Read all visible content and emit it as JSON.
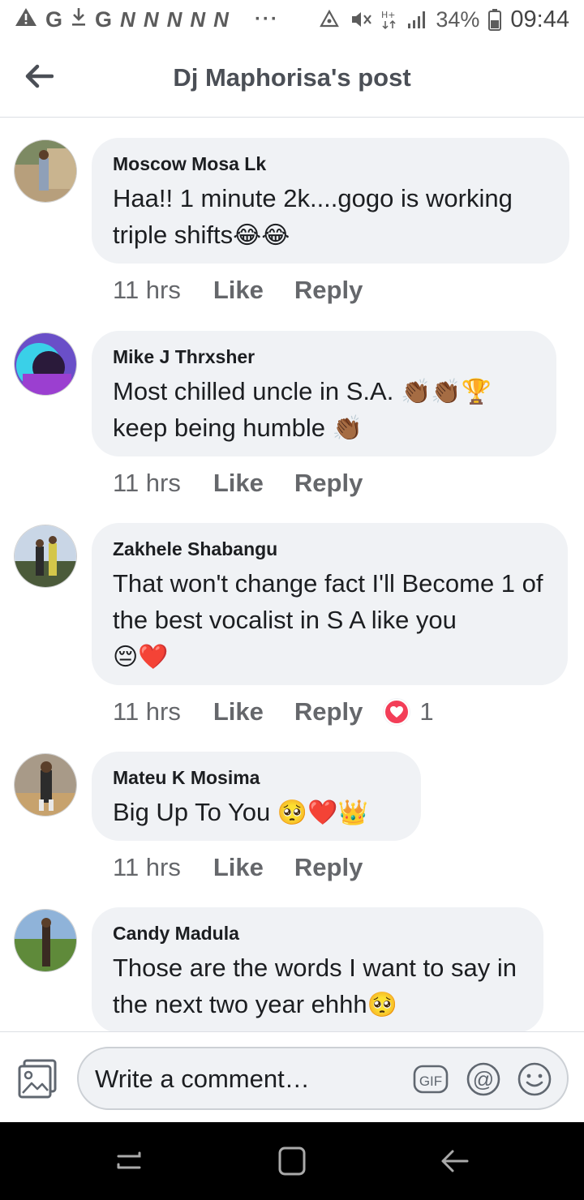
{
  "status_bar": {
    "left_glyphs": [
      "A",
      "G",
      "G"
    ],
    "n_icons": [
      "N",
      "N",
      "N",
      "N",
      "N"
    ],
    "dots": "···",
    "battery_pct": "34%",
    "time": "09:44"
  },
  "header": {
    "title": "Dj Maphorisa's post"
  },
  "comments": [
    {
      "name": "Moscow Mosa Lk",
      "text": "Haa!! 1 minute 2k....gogo is working triple shifts",
      "emoji": "😂😂",
      "time": "11 hrs",
      "like": "Like",
      "reply": "Reply"
    },
    {
      "name": "Mike J Thrxsher",
      "text1": "Most chilled uncle in S.A. ",
      "emoji1": "👏🏾👏🏾🏆",
      "text2": "keep being humble ",
      "emoji2": "👏🏾",
      "time": "11 hrs",
      "like": "Like",
      "reply": "Reply"
    },
    {
      "name": "Zakhele Shabangu",
      "text": "That won't change fact I'll Become 1 of the best vocalist in S A like you",
      "emoji": "😔❤️",
      "time": "11 hrs",
      "like": "Like",
      "reply": "Reply",
      "reaction_count": "1"
    },
    {
      "name": "Mateu K Mosima",
      "text": "Big Up To You ",
      "emoji": "🥺❤️👑",
      "time": "11 hrs",
      "like": "Like",
      "reply": "Reply"
    },
    {
      "name": "Candy Madula",
      "text": "Those are the words I want to say in the next two year ehhh",
      "emoji": "🥺"
    }
  ],
  "composer": {
    "placeholder": "Write a comment…",
    "gif_label": "GIF",
    "at_label": "@"
  },
  "colors": {
    "bubble": "#f0f2f5",
    "action_text": "#65676b",
    "heart": "#f33e58",
    "nav_bg": "#000000"
  },
  "icons": [
    "back-arrow-icon",
    "photo-icon",
    "gif-icon",
    "mention-icon",
    "smiley-icon",
    "recent-apps-icon",
    "home-icon",
    "back-icon",
    "heart-icon"
  ]
}
